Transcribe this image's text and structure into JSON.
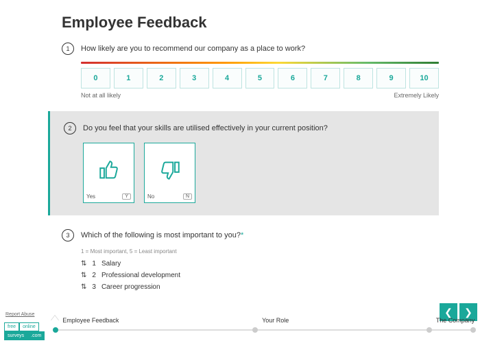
{
  "title": "Employee Feedback",
  "q1": {
    "number": "1",
    "text": "How likely are you to recommend our company as a place to work?",
    "options": [
      "0",
      "1",
      "2",
      "3",
      "4",
      "5",
      "6",
      "7",
      "8",
      "9",
      "10"
    ],
    "left_label": "Not at all likely",
    "right_label": "Extremely Likely"
  },
  "q2": {
    "number": "2",
    "text": "Do you feel that your skills are utilised effectively in your current position?",
    "yes_label": "Yes",
    "yes_key": "Y",
    "no_label": "No",
    "no_key": "N"
  },
  "q3": {
    "number": "3",
    "text": "Which of the following is most important to you?",
    "required": "*",
    "hint": "1 = Most important, 5 = Least important",
    "items": [
      {
        "rank": "1",
        "label": "Salary"
      },
      {
        "rank": "2",
        "label": "Professional development"
      },
      {
        "rank": "3",
        "label": "Career progression"
      }
    ]
  },
  "footer": {
    "report": "Report Abuse",
    "badge": {
      "a": "free",
      "b": "online",
      "c": "surveys",
      "d": ".com"
    },
    "stops": [
      {
        "label": "Employee Feedback",
        "pos": 0,
        "active": true
      },
      {
        "label": "Your Role",
        "pos": 47,
        "active": false
      },
      {
        "label": "The Company",
        "pos": 88,
        "active": false
      }
    ]
  }
}
